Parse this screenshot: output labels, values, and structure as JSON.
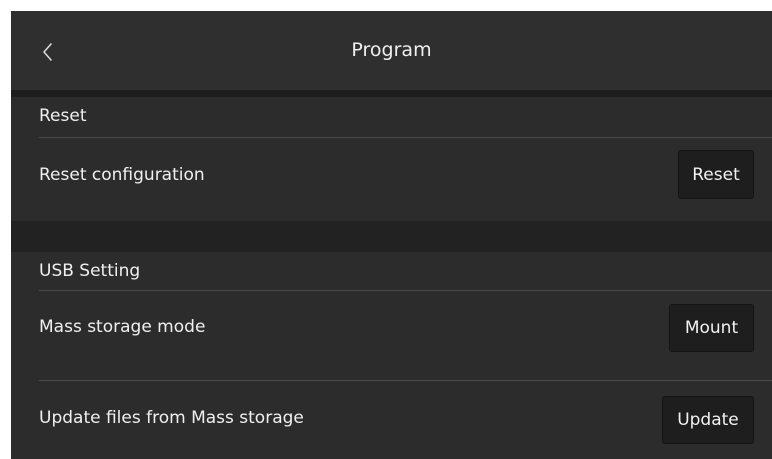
{
  "header": {
    "title": "Program",
    "back_icon": "chevron-left-icon"
  },
  "reset_section": {
    "title": "Reset",
    "rows": [
      {
        "label": "Reset configuration",
        "button": "Reset"
      }
    ]
  },
  "usb_section": {
    "title": "USB Setting",
    "rows": [
      {
        "label": "Mass storage mode",
        "button": "Mount"
      },
      {
        "label": "Update files from Mass storage",
        "button": "Update"
      }
    ]
  },
  "colors": {
    "background": "#2c2c2c",
    "header": "#2f2f2f",
    "button": "#1e1e1e",
    "text": "#f0f0f0",
    "divider": "#4a4a4a"
  }
}
